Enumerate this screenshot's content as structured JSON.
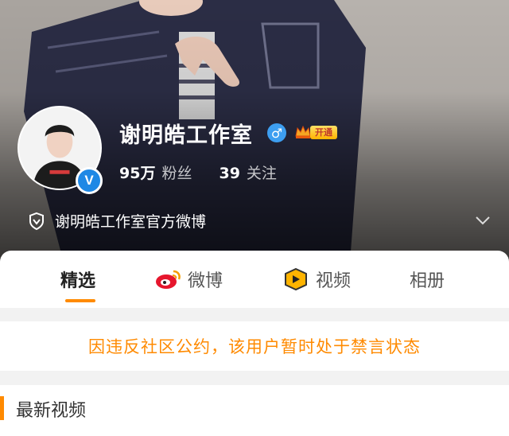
{
  "profile": {
    "name": "谢明皓工作室",
    "gender_icon": "male-icon",
    "vip_label": "开通",
    "fans_count": "95万",
    "fans_label": "粉丝",
    "following_count": "39",
    "following_label": "关注",
    "verification": "谢明皓工作室官方微博"
  },
  "tabs": [
    {
      "label": "精选",
      "icon": ""
    },
    {
      "label": "微博",
      "icon": "weibo-icon"
    },
    {
      "label": "视频",
      "icon": "video-icon"
    },
    {
      "label": "相册",
      "icon": ""
    }
  ],
  "notice": "因违反社区公约，该用户暂时处于禁言状态",
  "section": {
    "title": "最新视频"
  },
  "colors": {
    "accent": "#ff8a00",
    "verified_blue": "#1e88e5"
  }
}
